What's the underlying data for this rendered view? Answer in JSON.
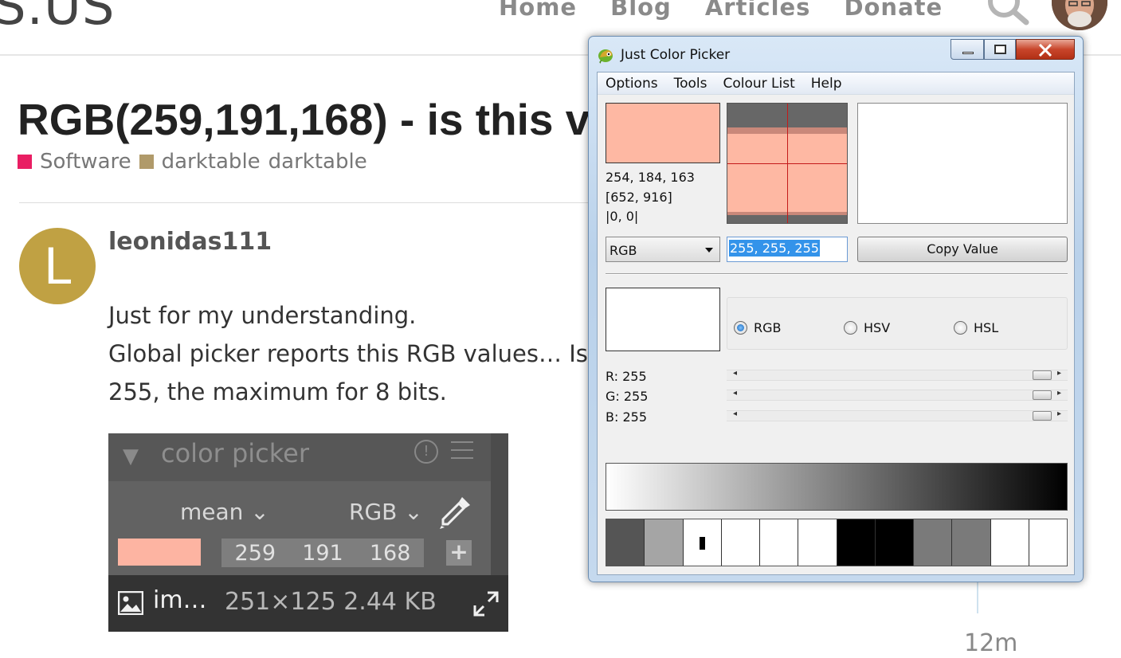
{
  "site": {
    "logo_text": "S.US",
    "nav": [
      "Home",
      "Blog",
      "Articles",
      "Donate"
    ]
  },
  "topic": {
    "title": "RGB(259,191,168) - is this v",
    "categories": [
      {
        "label": "Software",
        "color": "#e91e63"
      },
      {
        "label": "darktable",
        "color": "#b09a6a"
      },
      {
        "label": "darktable",
        "color": ""
      }
    ]
  },
  "post": {
    "avatar_letter": "L",
    "username": "leonidas111",
    "lines": [
      "Just for my understanding.",
      "Global picker reports this RGB values… Is",
      "255, the maximum for 8 bits."
    ],
    "image": {
      "panel_title": "color picker",
      "mode": "mean",
      "colorspace": "RGB",
      "values": [
        "259",
        "191",
        "168"
      ],
      "filename": "im…",
      "meta": "251×125 2.44 KB"
    },
    "time": "12m"
  },
  "picker": {
    "title": "Just Color Picker",
    "menu": [
      "Options",
      "Tools",
      "Colour List",
      "Help"
    ],
    "info": [
      "254, 184, 163",
      "[652, 916]",
      "|0, 0|"
    ],
    "format": "RGB",
    "value": "255, 255, 255",
    "copy_label": "Copy Value",
    "radios": [
      {
        "label": "RGB",
        "checked": true
      },
      {
        "label": "HSV",
        "checked": false
      },
      {
        "label": "HSL",
        "checked": false
      }
    ],
    "sliders": [
      {
        "label": "R: 255",
        "value": 255
      },
      {
        "label": "G: 255",
        "value": 255
      },
      {
        "label": "B: 255",
        "value": 255
      }
    ],
    "palette": [
      "#555555",
      "#a5a5a5",
      "#ffffff",
      "#ffffff",
      "#ffffff",
      "#ffffff",
      "#000000",
      "#000000",
      "#7a7a7a",
      "#7a7a7a",
      "#ffffff",
      "#ffffff"
    ],
    "colors": {
      "picked": "#feb8a3",
      "accent": "#3393ea"
    }
  }
}
